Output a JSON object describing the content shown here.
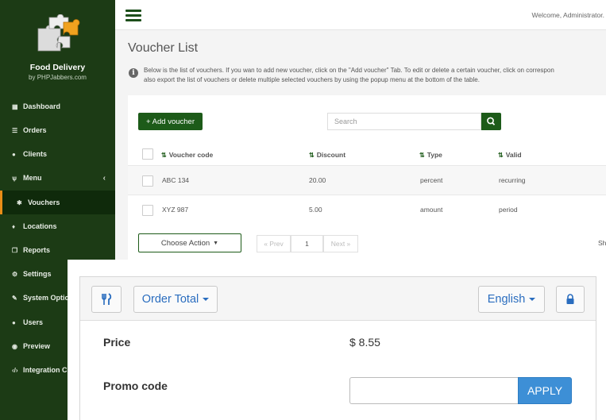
{
  "sidebar": {
    "brand": "Food Delivery",
    "brand_sub": "by PHPJabbers.com",
    "items": [
      {
        "label": "Dashboard",
        "icon": "dashboard-icon"
      },
      {
        "label": "Orders",
        "icon": "list-icon"
      },
      {
        "label": "Clients",
        "icon": "user-icon"
      },
      {
        "label": "Menu",
        "icon": "cutlery-icon"
      },
      {
        "label": "Vouchers",
        "icon": "gift-icon"
      },
      {
        "label": "Locations",
        "icon": "map-marker-icon"
      },
      {
        "label": "Reports",
        "icon": "copy-icon"
      },
      {
        "label": "Settings",
        "icon": "cogs-icon"
      },
      {
        "label": "System Optio",
        "icon": "wrench-icon"
      },
      {
        "label": "Users",
        "icon": "users-icon"
      },
      {
        "label": "Preview",
        "icon": "eye-icon"
      },
      {
        "label": "Integration C",
        "icon": "code-icon"
      }
    ]
  },
  "header": {
    "welcome": "Welcome, Administrator."
  },
  "page": {
    "title": "Voucher List",
    "info_line1": "Below is the list of vouchers. If you wan to add new voucher, click on the \"Add voucher\" Tab. To edit or delete a certain voucher, click on correspon",
    "info_line2": "also export the list of vouchers or delete multiple selected vouchers by using the popup menu at the bottom of the table."
  },
  "toolbar": {
    "add_label": "+ Add voucher",
    "search_placeholder": "Search"
  },
  "table": {
    "columns": [
      "Voucher code",
      "Discount",
      "Type",
      "Valid"
    ],
    "rows": [
      {
        "code": "ABC 134",
        "discount": "20.00",
        "type": "percent",
        "valid": "recurring"
      },
      {
        "code": "XYZ 987",
        "discount": "5.00",
        "type": "amount",
        "valid": "period"
      }
    ]
  },
  "footer": {
    "choose_action": "Choose Action",
    "prev": "« Prev",
    "page": "1",
    "next": "Next »",
    "show": "Sh"
  },
  "widget": {
    "order_total": "Order Total",
    "language": "English",
    "price_label": "Price",
    "price_value": "$ 8.55",
    "promo_label": "Promo code",
    "promo_value": "",
    "apply_label": "APPLY"
  },
  "colors": {
    "sidebar_bg": "#1c3b15",
    "accent_green": "#1d5b19",
    "active_marker": "#e98d17",
    "link_blue": "#2a6dbf",
    "apply_blue": "#3d8fd6"
  }
}
